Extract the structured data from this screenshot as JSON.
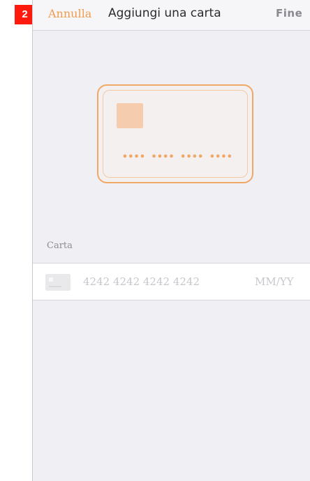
{
  "step_badge": "2",
  "navbar": {
    "cancel_label": "Annulla",
    "title": "Aggiungi una carta",
    "done_label": "Fine"
  },
  "card_preview": {
    "number_placeholder": "•••• •••• •••• ••••"
  },
  "form": {
    "section_label": "Carta",
    "card_number": {
      "value": "",
      "placeholder": "4242 4242 4242 4242"
    },
    "expiry": {
      "value": "",
      "placeholder": "MM/YY"
    }
  },
  "colors": {
    "accent": "#f29a4d",
    "badge": "#ff1a0e",
    "background": "#efeff4"
  },
  "icons": {
    "card_icon": "credit-card-icon"
  }
}
